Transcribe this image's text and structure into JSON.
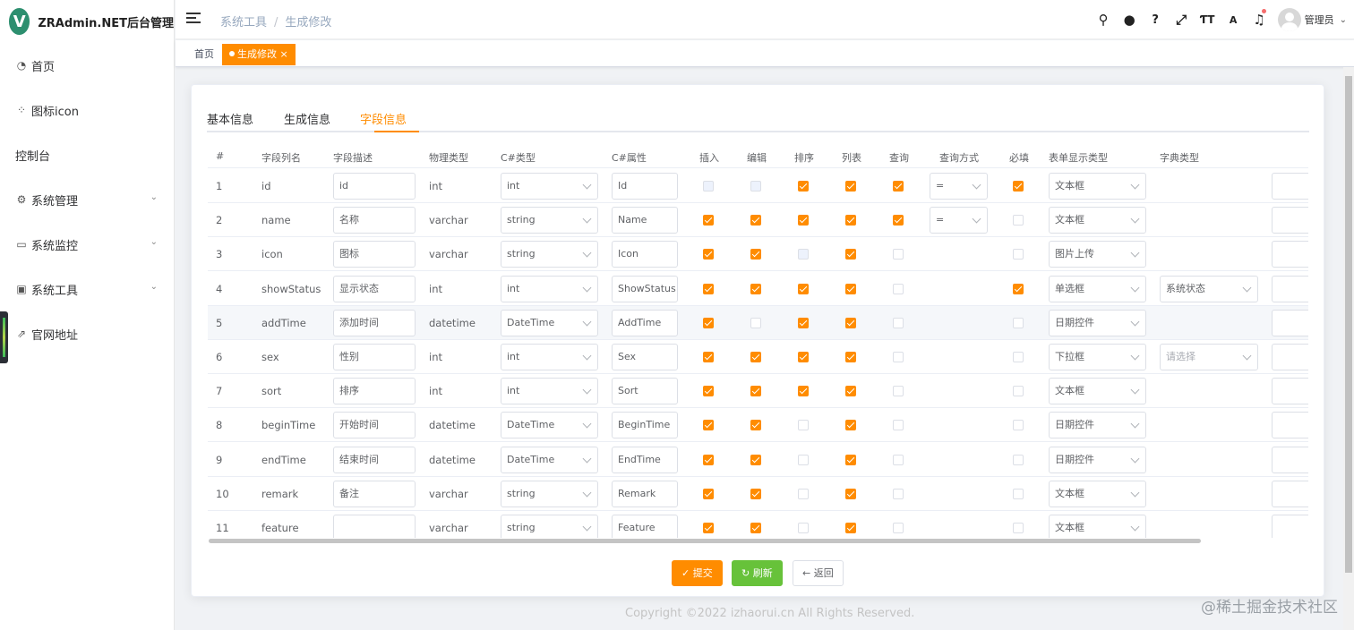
{
  "app": {
    "logo_letter": "V",
    "title": "ZRAdmin.NET后台管理"
  },
  "sidebar": {
    "items": [
      {
        "label": "首页",
        "icon": "dashboard-icon",
        "has_arrow": false
      },
      {
        "label": "图标icon",
        "icon": "grid-icon",
        "has_arrow": false
      },
      {
        "label": "控制台",
        "icon": "",
        "has_arrow": false
      },
      {
        "label": "系统管理",
        "icon": "gear-icon",
        "has_arrow": true
      },
      {
        "label": "系统监控",
        "icon": "monitor-icon",
        "has_arrow": true
      },
      {
        "label": "系统工具",
        "icon": "toolbox-icon",
        "has_arrow": true
      },
      {
        "label": "官网地址",
        "icon": "external-link-icon",
        "has_arrow": false
      }
    ]
  },
  "breadcrumb": {
    "items": [
      "系统工具",
      "生成修改"
    ]
  },
  "header": {
    "icons": [
      "search-icon",
      "github-icon",
      "help-icon",
      "fullscreen-icon",
      "font-size-icon",
      "translate-icon",
      "bell-icon"
    ],
    "username": "管理员"
  },
  "tags": {
    "home": "首页",
    "active": "生成修改"
  },
  "tabs": [
    "基本信息",
    "生成信息",
    "字段信息"
  ],
  "table": {
    "headers": [
      "#",
      "字段列名",
      "字段描述",
      "物理类型",
      "C#类型",
      "C#属性",
      "插入",
      "编辑",
      "排序",
      "列表",
      "查询",
      "查询方式",
      "必填",
      "表单显示类型",
      "字典类型"
    ],
    "rows": [
      {
        "idx": "1",
        "col": "id",
        "desc": "id",
        "phys": "int",
        "cstype": "int",
        "prop": "Id",
        "insert": "dis",
        "edit": "dis",
        "sort": "on",
        "list": "on",
        "query": "on",
        "querytype": "=",
        "required": "on",
        "form": "文本框",
        "dict": ""
      },
      {
        "idx": "2",
        "col": "name",
        "desc": "名称",
        "phys": "varchar",
        "cstype": "string",
        "prop": "Name",
        "insert": "on",
        "edit": "on",
        "sort": "on",
        "list": "on",
        "query": "on",
        "querytype": "=",
        "required": "off",
        "form": "文本框",
        "dict": ""
      },
      {
        "idx": "3",
        "col": "icon",
        "desc": "图标",
        "phys": "varchar",
        "cstype": "string",
        "prop": "Icon",
        "insert": "on",
        "edit": "on",
        "sort": "dis",
        "list": "on",
        "query": "off",
        "querytype": "",
        "required": "off",
        "form": "图片上传",
        "dict": ""
      },
      {
        "idx": "4",
        "col": "showStatus",
        "desc": "显示状态",
        "phys": "int",
        "cstype": "int",
        "prop": "ShowStatus",
        "insert": "on",
        "edit": "on",
        "sort": "on",
        "list": "on",
        "query": "off",
        "querytype": "",
        "required": "on",
        "form": "单选框",
        "dict": "系统状态"
      },
      {
        "idx": "5",
        "col": "addTime",
        "desc": "添加时间",
        "phys": "datetime",
        "cstype": "DateTime",
        "prop": "AddTime",
        "insert": "on",
        "edit": "off",
        "sort": "on",
        "list": "on",
        "query": "off",
        "querytype": "",
        "required": "off",
        "form": "日期控件",
        "dict": ""
      },
      {
        "idx": "6",
        "col": "sex",
        "desc": "性别",
        "phys": "int",
        "cstype": "int",
        "prop": "Sex",
        "insert": "on",
        "edit": "on",
        "sort": "on",
        "list": "on",
        "query": "off",
        "querytype": "",
        "required": "off",
        "form": "下拉框",
        "dict": "",
        "dict_placeholder": "请选择"
      },
      {
        "idx": "7",
        "col": "sort",
        "desc": "排序",
        "phys": "int",
        "cstype": "int",
        "prop": "Sort",
        "insert": "on",
        "edit": "on",
        "sort": "on",
        "list": "on",
        "query": "off",
        "querytype": "",
        "required": "off",
        "form": "文本框",
        "dict": ""
      },
      {
        "idx": "8",
        "col": "beginTime",
        "desc": "开始时间",
        "phys": "datetime",
        "cstype": "DateTime",
        "prop": "BeginTime",
        "insert": "on",
        "edit": "on",
        "sort": "off",
        "list": "on",
        "query": "off",
        "querytype": "",
        "required": "off",
        "form": "日期控件",
        "dict": ""
      },
      {
        "idx": "9",
        "col": "endTime",
        "desc": "结束时间",
        "phys": "datetime",
        "cstype": "DateTime",
        "prop": "EndTime",
        "insert": "on",
        "edit": "on",
        "sort": "off",
        "list": "on",
        "query": "off",
        "querytype": "",
        "required": "off",
        "form": "日期控件",
        "dict": ""
      },
      {
        "idx": "10",
        "col": "remark",
        "desc": "备注",
        "phys": "varchar",
        "cstype": "string",
        "prop": "Remark",
        "insert": "on",
        "edit": "on",
        "sort": "off",
        "list": "on",
        "query": "off",
        "querytype": "",
        "required": "off",
        "form": "文本框",
        "dict": ""
      },
      {
        "idx": "11",
        "col": "feature",
        "desc": "",
        "phys": "varchar",
        "cstype": "string",
        "prop": "Feature",
        "insert": "on",
        "edit": "on",
        "sort": "off",
        "list": "on",
        "query": "off",
        "querytype": "",
        "required": "off",
        "form": "文本框",
        "dict": ""
      }
    ]
  },
  "buttons": {
    "submit": "✓ 提交",
    "refresh": "↻ 刷新",
    "back": "← 返回"
  },
  "footer": "Copyright ©2022 izhaorui.cn All Rights Reserved.",
  "watermark": "@稀土掘金技术社区",
  "colors": {
    "accent": "#ff8c00",
    "success": "#67c23a"
  }
}
